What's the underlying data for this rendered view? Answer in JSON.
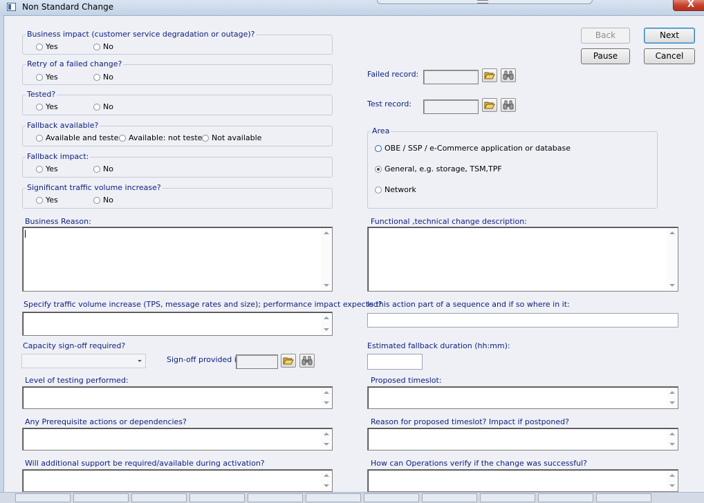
{
  "window": {
    "title": "Non Standard Change",
    "close_glyph": "X"
  },
  "buttons": {
    "back": "Back",
    "next": "Next",
    "pause": "Pause",
    "cancel": "Cancel"
  },
  "questions": {
    "business_impact": {
      "legend": "Business impact (customer service degradation or outage)?",
      "options": [
        "Yes",
        "No"
      ]
    },
    "retry": {
      "legend": "Retry of a failed change?",
      "options": [
        "Yes",
        "No"
      ]
    },
    "tested": {
      "legend": "Tested?",
      "options": [
        "Yes",
        "No"
      ]
    },
    "fallback_available": {
      "legend": "Fallback available?",
      "options": [
        "Available and tested",
        "Available: not tested",
        "Not available"
      ]
    },
    "fallback_impact": {
      "legend": "Fallback impact:",
      "options": [
        "Yes",
        "No"
      ]
    },
    "traffic_increase": {
      "legend": "Significant traffic volume increase?",
      "options": [
        "Yes",
        "No"
      ]
    }
  },
  "records": {
    "failed_label": "Failed record:",
    "test_label": "Test record:"
  },
  "area": {
    "legend": "Area",
    "options": [
      "OBE / SSP / e-Commerce application or database",
      "General, e.g. storage, TSM,TPF",
      "Network"
    ],
    "selected": "General, e.g. storage, TSM,TPF"
  },
  "fields": {
    "business_reason": "Business Reason:",
    "functional_description": "Functional ,technical change description:",
    "traffic_volume": "Specify traffic volume increase (TPS, message rates and size);  performance impact expected?",
    "sequence": "Is this action part of a sequence and if so where in it:",
    "capacity_signoff": "Capacity sign-off required?",
    "signoff_provided": "Sign-off provided in:",
    "fallback_duration": "Estimated fallback duration (hh:mm):",
    "testing_level": "Level of testing performed:",
    "proposed_timeslot": "Proposed timeslot:",
    "prerequisites": "Any Prerequisite actions or dependencies?",
    "timeslot_reason": "Reason for proposed timeslot? Impact if postponed?",
    "additional_support": "Will additional support be required/available during activation?",
    "verify_success": "How can Operations verify if  the change was successful?"
  },
  "icons": {
    "open": "folder-open-icon",
    "find": "binoculars-icon"
  },
  "colors": {
    "label": "#10207e",
    "background": "#eef0f6",
    "close": "#c7402a"
  }
}
